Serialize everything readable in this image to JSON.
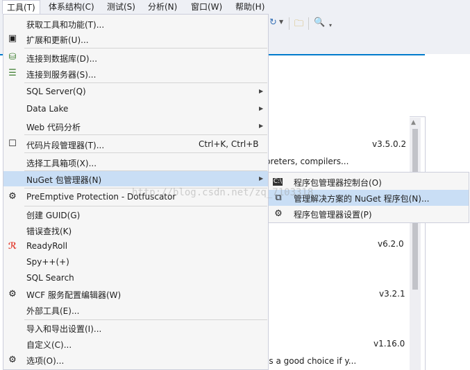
{
  "menubar": {
    "items": [
      {
        "label": "工具(T)"
      },
      {
        "label": "体系结构(C)"
      },
      {
        "label": "测试(S)"
      },
      {
        "label": "分析(N)"
      },
      {
        "label": "窗口(W)"
      },
      {
        "label": "帮助(H)"
      }
    ]
  },
  "tools_menu": {
    "items": [
      {
        "label": "获取工具和功能(T)...",
        "icon": "none"
      },
      {
        "label": "扩展和更新(U)...",
        "icon": "extensions-icon"
      },
      {
        "label": "连接到数据库(D)...",
        "icon": "database-connect-icon"
      },
      {
        "label": "连接到服务器(S)...",
        "icon": "server-connect-icon"
      },
      {
        "label": "SQL Server(Q)",
        "submenu": true
      },
      {
        "label": "Data Lake",
        "submenu": true
      },
      {
        "label": "Web 代码分析",
        "submenu": true
      },
      {
        "label": "代码片段管理器(T)...",
        "shortcut": "Ctrl+K, Ctrl+B",
        "icon": "snippet-icon"
      },
      {
        "label": "选择工具箱项(X)..."
      },
      {
        "label": "NuGet 包管理器(N)",
        "submenu": true,
        "highlighted": true
      },
      {
        "label": "PreEmptive Protection - Dotfuscator",
        "icon": "gear-outline-icon"
      },
      {
        "label": "创建 GUID(G)"
      },
      {
        "label": "错误查找(K)"
      },
      {
        "label": "ReadyRoll",
        "icon": "readyroll-icon"
      },
      {
        "label": "Spy++(+)"
      },
      {
        "label": "SQL Search"
      },
      {
        "label": "WCF 服务配置编辑器(W)",
        "icon": "wcf-gear-icon"
      },
      {
        "label": "外部工具(E)..."
      },
      {
        "label": "导入和导出设置(I)..."
      },
      {
        "label": "自定义(C)..."
      },
      {
        "label": "选项(O)...",
        "icon": "gear-icon"
      }
    ]
  },
  "nuget_submenu": {
    "items": [
      {
        "label": "程序包管理器控制台(O)",
        "icon": "console-icon"
      },
      {
        "label": "管理解决方案的 NuGet 程序包(N)...",
        "icon": "package-icon",
        "highlighted": true
      },
      {
        "label": "程序包管理器设置(P)",
        "icon": "gear-icon"
      }
    ]
  },
  "background": {
    "versions": [
      "v3.5.0.2",
      "v6.2.0",
      "v3.2.1",
      "v1.16.0"
    ],
    "descriptions": [
      "rpreters, compilers...",
      "es a good choice if y..."
    ]
  },
  "watermark": "http://blog.csdn.net/zq_7103318",
  "colors": {
    "accent": "#007acc",
    "highlight": "#c9def5",
    "menu_bg": "#f6f6f6"
  }
}
